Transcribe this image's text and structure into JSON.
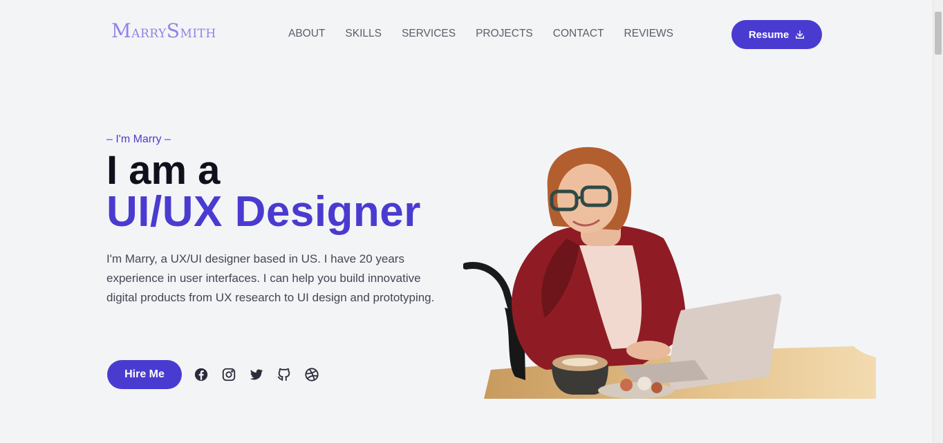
{
  "logo": {
    "first_initial": "M",
    "first_rest": "ARRY",
    "last_initial": "S",
    "last_rest": "MITH"
  },
  "nav": {
    "items": [
      {
        "label": "ABOUT"
      },
      {
        "label": "SKILLS"
      },
      {
        "label": "SERVICES"
      },
      {
        "label": "PROJECTS"
      },
      {
        "label": "CONTACT"
      },
      {
        "label": "REVIEWS"
      }
    ]
  },
  "resume_button": {
    "label": "Resume",
    "icon": "download-icon"
  },
  "hero": {
    "tagline": "– I'm Marry –",
    "heading_line1": "I am a",
    "heading_line2": "UI/UX Designer",
    "intro": "I'm Marry, a UX/UI designer based in US. I have 20 years experience in user interfaces. I can help you build innovative digital products from UX research to UI design and prototyping.",
    "hire_label": "Hire Me"
  },
  "socials": [
    {
      "icon": "facebook-icon"
    },
    {
      "icon": "instagram-icon"
    },
    {
      "icon": "twitter-icon"
    },
    {
      "icon": "github-icon"
    },
    {
      "icon": "dribbble-icon"
    }
  ],
  "colors": {
    "accent": "#4a3bd0",
    "logo": "#8f84e6",
    "background": "#f3f4f6",
    "dark_text": "#10101c"
  }
}
